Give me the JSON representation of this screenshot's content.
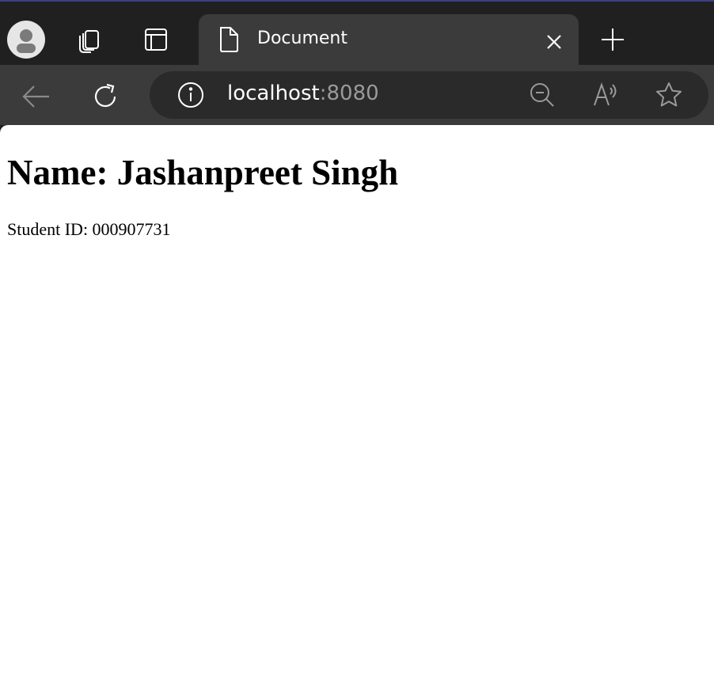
{
  "browser": {
    "tab": {
      "title": "Document"
    },
    "address": {
      "host": "localhost",
      "port": ":8080"
    },
    "icons": {
      "profile": "profile-avatar-icon",
      "workspaces": "workspaces-icon",
      "vertical_tabs": "vertical-tabs-icon",
      "page": "page-icon",
      "close": "close-icon",
      "new_tab": "plus-icon",
      "back": "back-arrow-icon",
      "refresh": "refresh-icon",
      "site_info": "info-icon",
      "zoom_out": "zoom-out-icon",
      "read_aloud": "read-aloud-icon",
      "favorite": "star-icon"
    },
    "colors": {
      "accent": "#3b3f86",
      "tabstrip": "#202020",
      "toolbar": "#3b3b3b",
      "omnibox": "#2a2a2a"
    }
  },
  "page": {
    "heading": "Name: Jashanpreet Singh",
    "student_id": "Student ID: 000907731"
  }
}
